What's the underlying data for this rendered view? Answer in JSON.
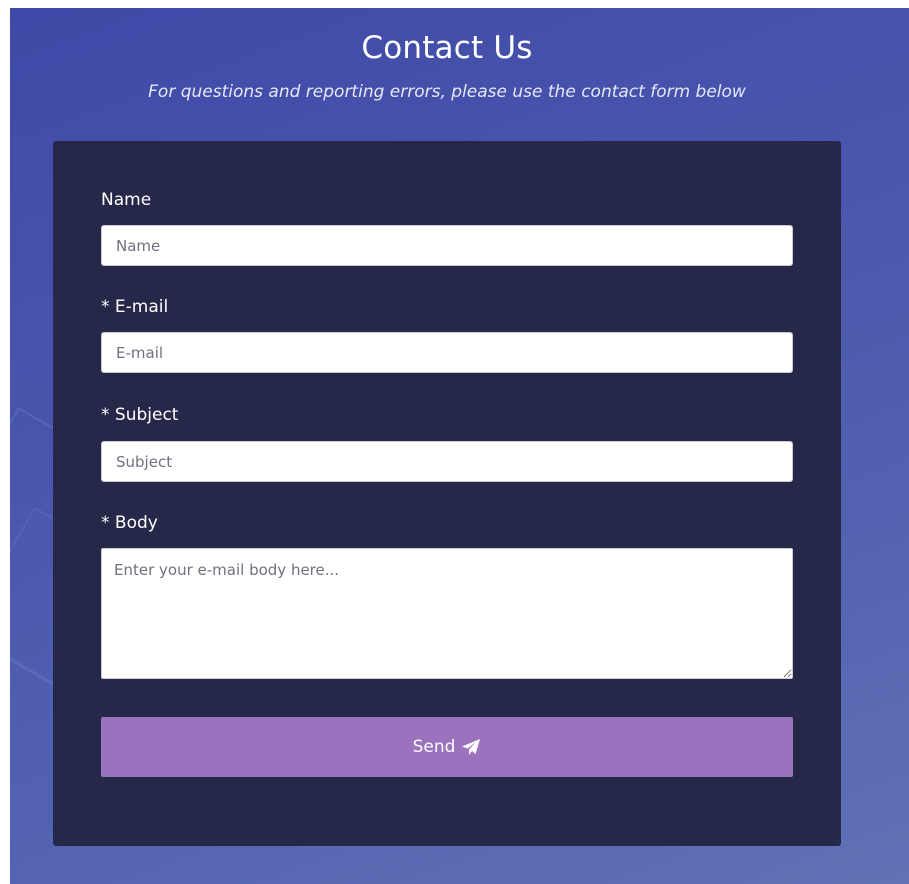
{
  "header": {
    "title": "Contact Us",
    "subtitle": "For questions and reporting errors, please use the contact form below"
  },
  "form": {
    "name": {
      "label": "Name",
      "placeholder": "Name",
      "value": ""
    },
    "email": {
      "label": "* E-mail",
      "placeholder": "E-mail",
      "value": ""
    },
    "subject": {
      "label": "* Subject",
      "placeholder": "Subject",
      "value": ""
    },
    "body": {
      "label": "* Body",
      "placeholder": "Enter your e-mail body here...",
      "value": ""
    },
    "send": {
      "label": "Send",
      "icon": "paper-plane-icon"
    }
  },
  "colors": {
    "background_start": "#3f4aa8",
    "background_end": "#6172b6",
    "card": "#26284a",
    "button": "#9a72be",
    "text": "#ffffff"
  }
}
